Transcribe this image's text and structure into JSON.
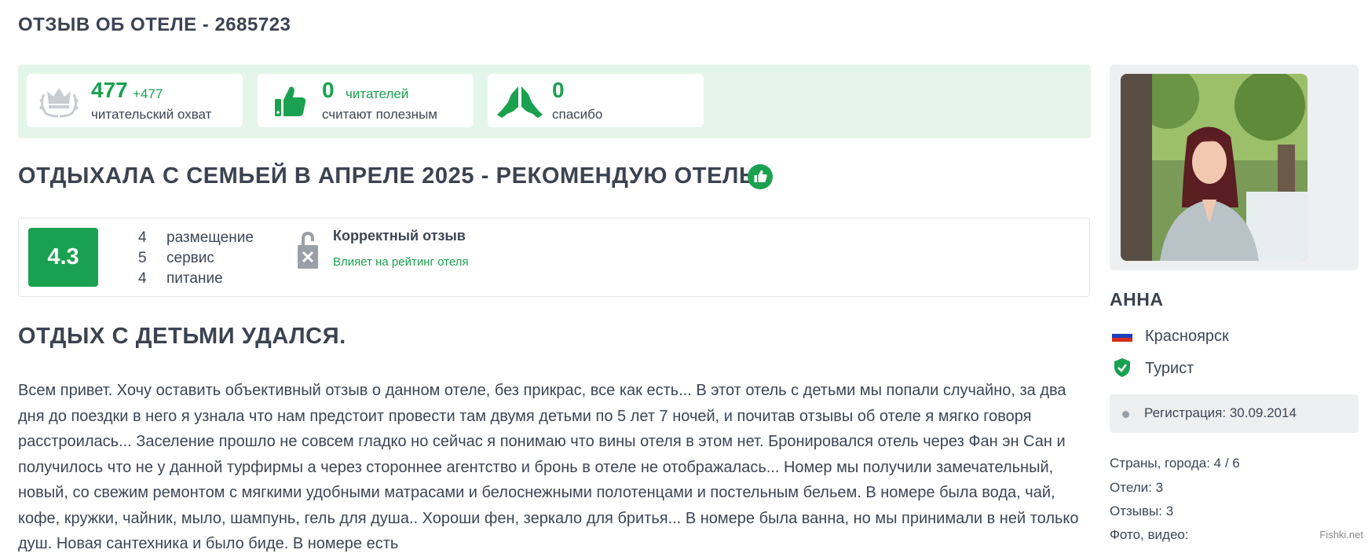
{
  "page_title": "ОТЗЫВ ОБ ОТЕЛЕ - 2685723",
  "stats": {
    "reach": {
      "value": "477",
      "delta": "+477",
      "label": "читательский охват",
      "icon": "crown-laurel-icon"
    },
    "useful": {
      "value": "0",
      "unit": "читателей",
      "label": "считают полезным",
      "icon": "thumbs-up-icon"
    },
    "thanks": {
      "value": "0",
      "label": "спасибо",
      "icon": "praying-hands-icon"
    }
  },
  "review_title": "ОТДЫХАЛА С СЕМЬЕЙ В АПРЕЛЕ 2025 - РЕКОМЕНДУЮ ОТЕЛЬ",
  "rating": {
    "overall": "4.3",
    "criteria": [
      {
        "value": "4",
        "label": "размещение"
      },
      {
        "value": "5",
        "label": "сервис"
      },
      {
        "value": "4",
        "label": "питание"
      }
    ],
    "correct_title": "Корректный отзыв",
    "correct_subtitle": "Влияет на рейтинг отеля"
  },
  "subheading": "ОТДЫХ С ДЕТЬМИ УДАЛСЯ.",
  "body": "Всем привет. Хочу оставить объективный отзыв о данном отеле, без прикрас, все как есть... В этот отель с детьми мы попали случайно, за два дня до поездки в него я узнала что нам предстоит провести там двумя детьми по 5 лет 7 ночей, и почитав отзывы об отеле я мягко говоря расстроилась... Заселение прошло не совсем гладко но сейчас я понимаю что вины отеля в этом нет. Бронировался отель через Фан эн Сан и получилось что не у данной турфирмы а через стороннее агентство и бронь в отеле не отображалась... Номер мы получили замечательный, новый, со свежим ремонтом с мягкими удобными матрасами и белоснежными полотенцами и постельным бельем. В номере была вода, чай, кофе, кружки, чайник, мыло, шампунь, гель для душа.. Хороши фен, зеркало для бритья... В номере была ванна, но мы принимали в ней только душ. Новая сантехника и было биде. В номере есть",
  "author": {
    "name": "АННА",
    "city": "Красноярск",
    "status": "Турист",
    "registration": "Регистрация: 30.09.2014",
    "meta": [
      "Страны, города: 4 / 6",
      "Отели: 3",
      "Отзывы: 3",
      "Фото, видео:"
    ]
  },
  "watermark": "Fishki.net",
  "colors": {
    "accent": "#1aa150",
    "stats_bg": "#e4f6ea",
    "text": "#3d4654"
  }
}
